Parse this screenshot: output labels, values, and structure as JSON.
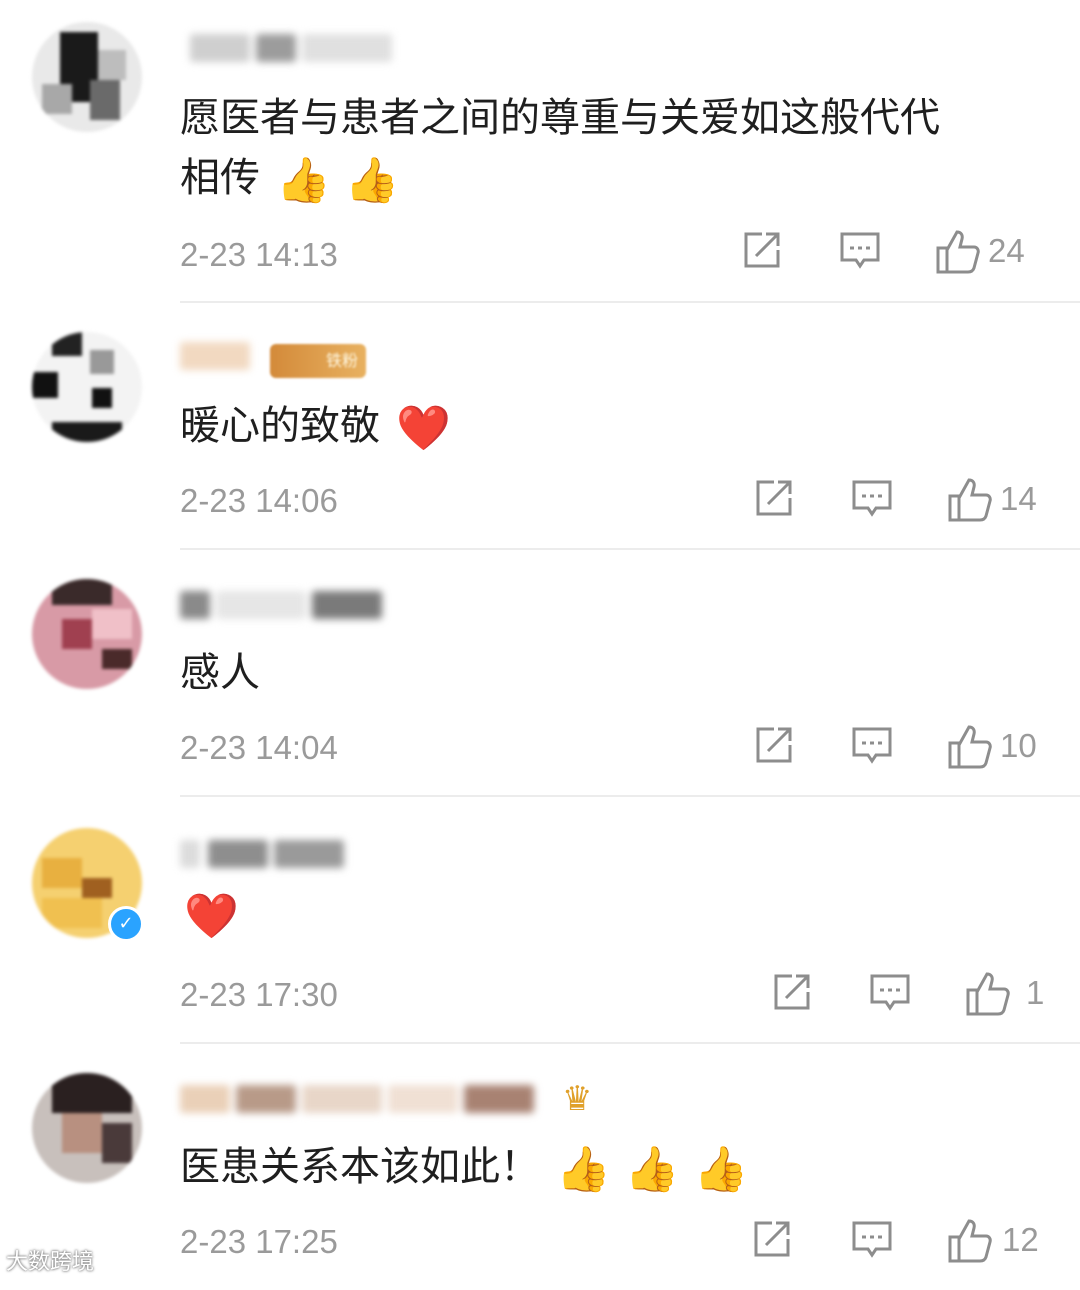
{
  "comments": [
    {
      "text": "愿医者与患者之间的尊重与关爱如这般代代",
      "text2": "相传",
      "emoji": "👍 👍",
      "time": "2-23 14:13",
      "likes": "24"
    },
    {
      "text": "暖心的致敬",
      "emoji": "❤️",
      "time": "2-23 14:06",
      "likes": "14",
      "badge": "铁粉"
    },
    {
      "text": "感人",
      "time": "2-23 14:04",
      "likes": "10"
    },
    {
      "text": "",
      "emoji": "❤️",
      "time": "2-23 17:30",
      "likes": "1"
    },
    {
      "text": "医患关系本该如此！",
      "emoji": "👍 👍 👍",
      "time": "2-23 17:25",
      "likes": "12"
    }
  ],
  "icons": {
    "share": "share-icon",
    "reply": "comment-icon",
    "like": "thumbs-up-icon"
  },
  "watermark": "大数跨境"
}
